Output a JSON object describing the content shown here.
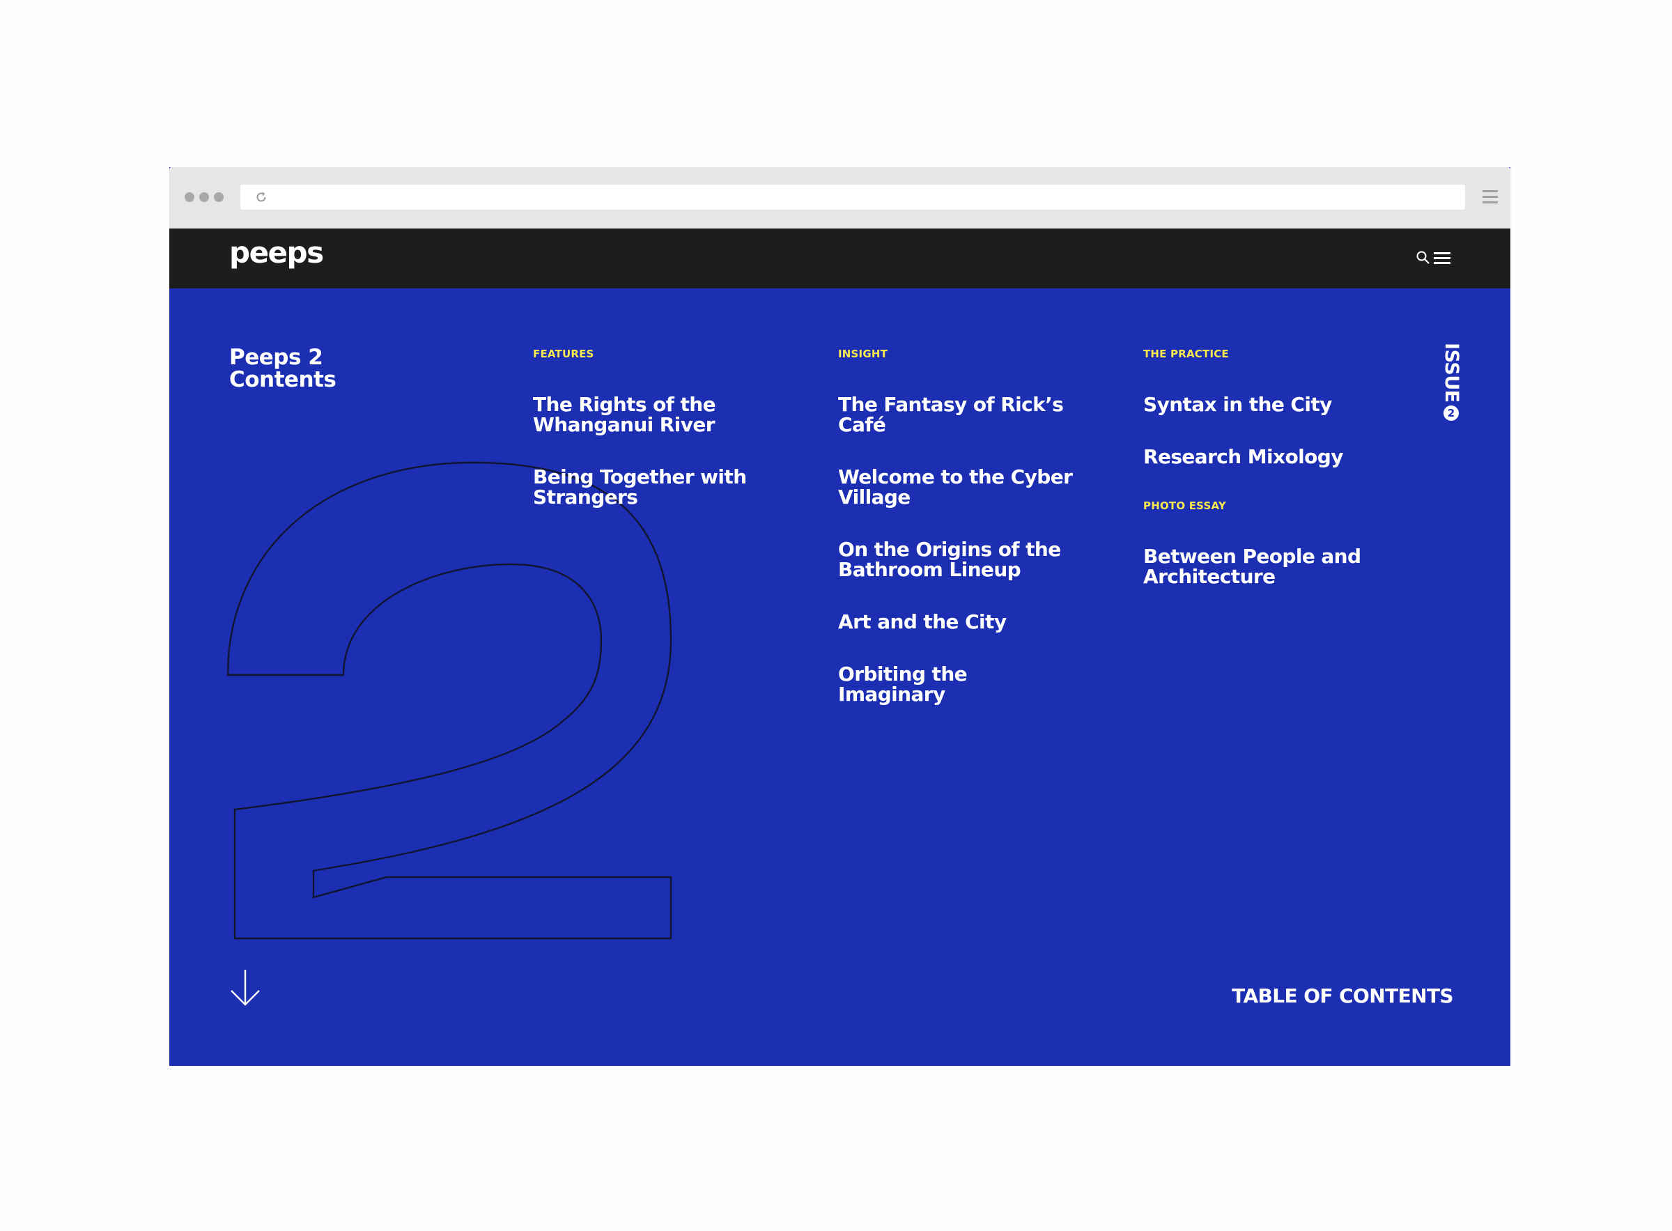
{
  "browser": {
    "address": ""
  },
  "site": {
    "logo": "peeps"
  },
  "page": {
    "title_line1": "Peeps 2",
    "title_line2": "Contents",
    "issue_label": "ISSUE",
    "issue_number": "2",
    "toc_label": "TABLE OF CONTENTS"
  },
  "sections": {
    "features": {
      "label": "FEATURES",
      "articles": [
        "The Rights of the Whanganui River",
        "Being Together with Strangers"
      ]
    },
    "insight": {
      "label": "INSIGHT",
      "articles": [
        "The Fantasy of Rick’s Café",
        "Welcome to the Cyber Village",
        "On the Origins of the Bathroom Lineup",
        "Art and the City",
        "Orbiting the Imaginary"
      ]
    },
    "practice": {
      "label": "THE PRACTICE",
      "articles": [
        "Syntax in the City",
        "Research Mixology"
      ]
    },
    "photo_essay": {
      "label": "PHOTO ESSAY",
      "articles": [
        "Between People and Architecture"
      ]
    }
  },
  "colors": {
    "background": "#1c2fb3",
    "nav": "#1d1d20",
    "accent": "#f6e94d",
    "text": "#ffffff"
  },
  "icons": [
    "reload-icon",
    "browser-menu-icon",
    "search-icon",
    "hamburger-menu-icon",
    "down-arrow-icon"
  ]
}
